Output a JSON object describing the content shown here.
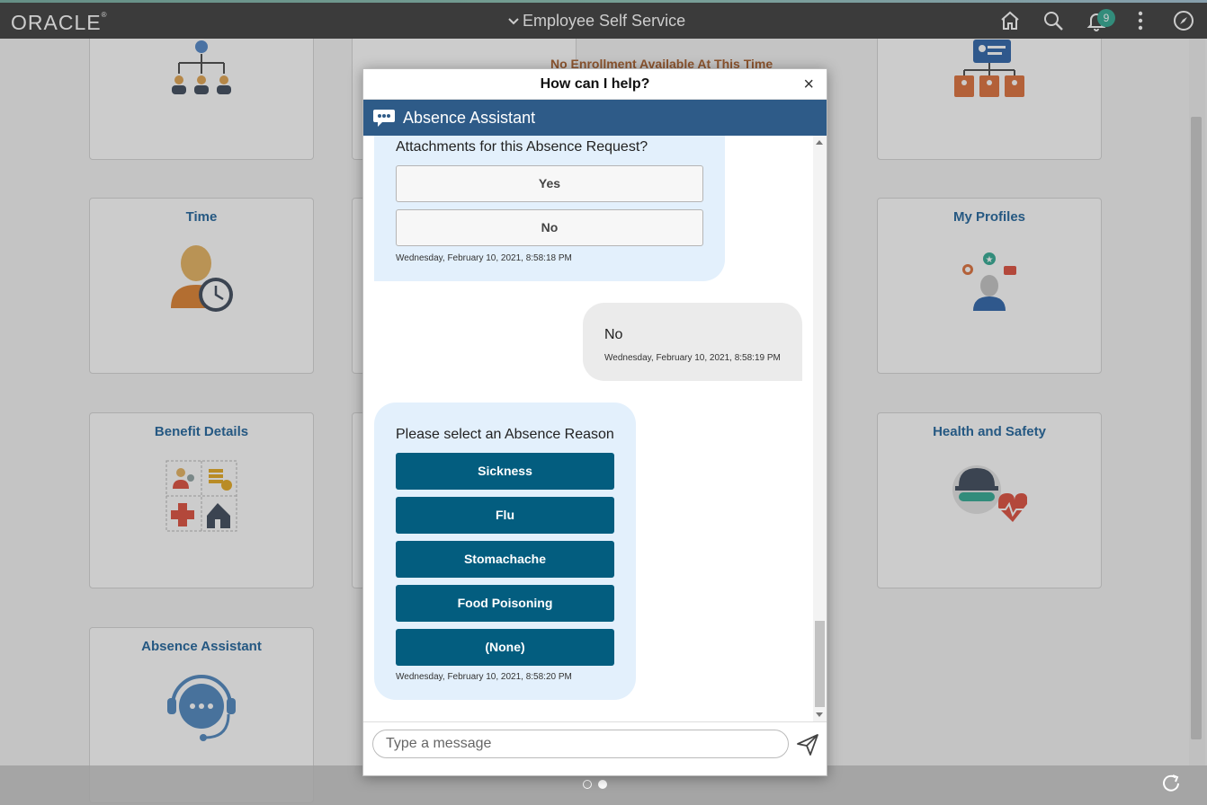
{
  "header": {
    "brand": "ORACLE",
    "title": "Employee Self Service",
    "notifications_count": "9",
    "icons": [
      "home-icon",
      "search-icon",
      "bell-icon",
      "more-vertical-icon",
      "compass-icon"
    ]
  },
  "tiles": {
    "org_chart": {
      "icon": "org-chart-icon"
    },
    "enrollment_note": "No Enrollment Available At This Time",
    "directory": {
      "icon": "directory-icon"
    },
    "time": {
      "title": "Time",
      "icon": "person-clock-icon"
    },
    "my_profiles": {
      "title": "My Profiles",
      "icon": "profile-badges-icon"
    },
    "benefit_details": {
      "title": "Benefit Details",
      "icon": "benefits-grid-icon"
    },
    "health_safety": {
      "title": "Health and Safety",
      "icon": "hardhat-heart-icon"
    },
    "absence_assistant": {
      "title": "Absence Assistant",
      "icon": "headset-chat-icon"
    }
  },
  "dialog": {
    "title": "How can I help?",
    "close_label": "×",
    "bot_name": "Absence Assistant",
    "messages": [
      {
        "from": "bot",
        "text": "Attachments for this Absence Request?",
        "options": [
          "Yes",
          "No"
        ],
        "timestamp": "Wednesday, February 10, 2021, 8:58:18 PM"
      },
      {
        "from": "user",
        "text": "No",
        "timestamp": "Wednesday, February 10, 2021, 8:58:19 PM"
      },
      {
        "from": "bot",
        "text": "Please select an Absence Reason",
        "options": [
          "Sickness",
          "Flu",
          "Stomachache",
          "Food Poisoning",
          "(None)"
        ],
        "timestamp": "Wednesday, February 10, 2021, 8:58:20 PM"
      }
    ],
    "input_placeholder": "Type a message"
  },
  "colors": {
    "header_bg": "#4a4a4a",
    "bot_bar": "#2e5b88",
    "option_dark": "#035d7f",
    "bot_bubble": "#e3f0fc",
    "user_bubble": "#ebebeb",
    "tile_title": "#2f6fa3",
    "badge": "#3fb09a"
  }
}
